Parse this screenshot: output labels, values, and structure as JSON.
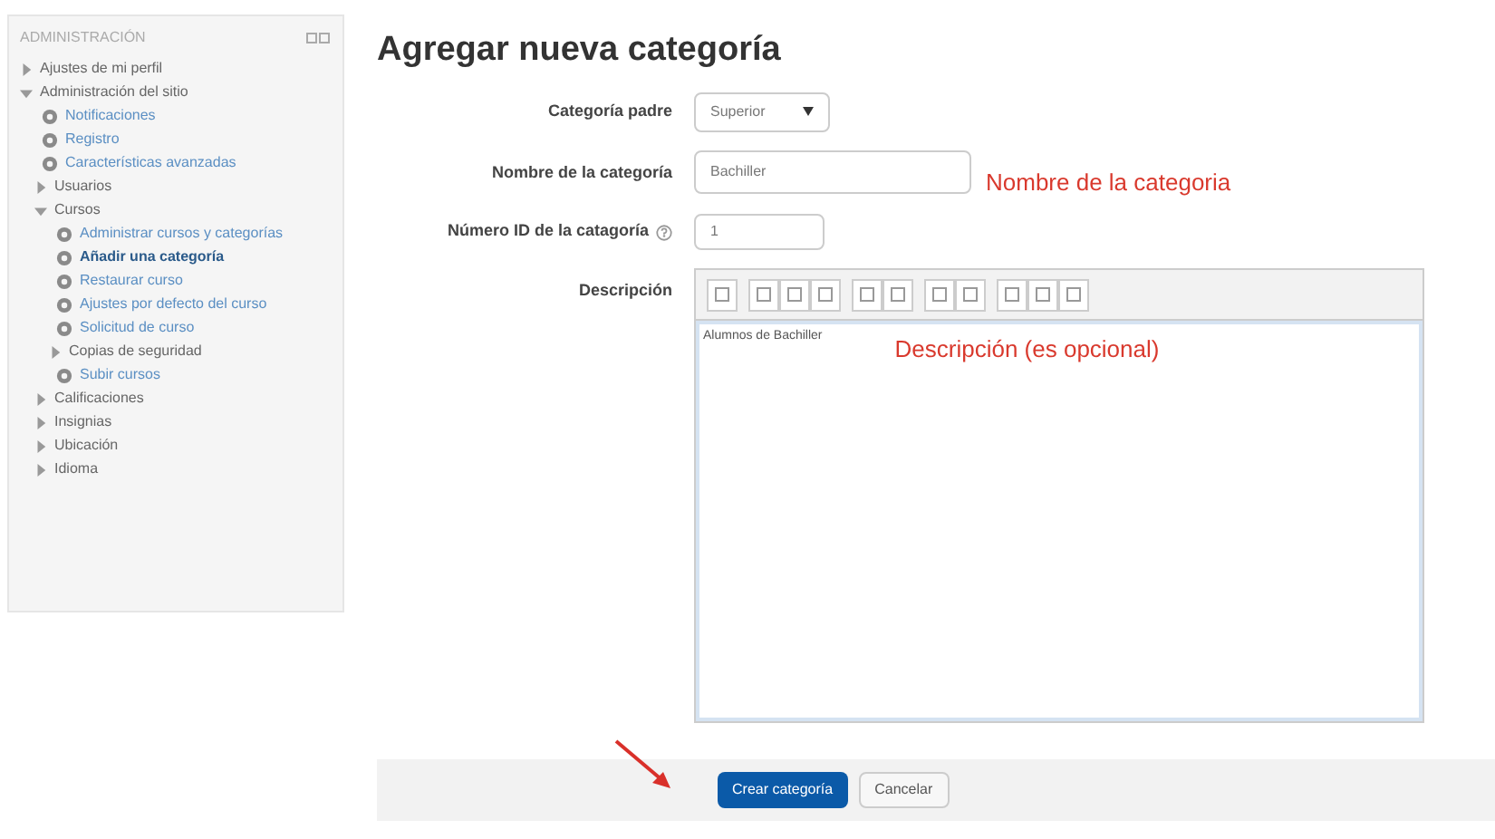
{
  "sidebar": {
    "title": "ADMINISTRACIÓN",
    "items": [
      {
        "kind": "branch",
        "label": "Ajustes de mi perfil",
        "expanded": false
      },
      {
        "kind": "branch",
        "label": "Administración del sitio",
        "expanded": true,
        "children": [
          {
            "kind": "link",
            "label": "Notificaciones",
            "selected": false
          },
          {
            "kind": "link",
            "label": "Registro",
            "selected": false
          },
          {
            "kind": "link",
            "label": "Características avanzadas",
            "selected": false
          },
          {
            "kind": "branch",
            "label": "Usuarios",
            "expanded": false
          },
          {
            "kind": "branch",
            "label": "Cursos",
            "expanded": true,
            "children": [
              {
                "kind": "link",
                "label": "Administrar cursos y categorías",
                "selected": false
              },
              {
                "kind": "link",
                "label": "Añadir una categoría",
                "selected": true
              },
              {
                "kind": "link",
                "label": "Restaurar curso",
                "selected": false
              },
              {
                "kind": "link",
                "label": "Ajustes por defecto del curso",
                "selected": false
              },
              {
                "kind": "link",
                "label": "Solicitud de curso",
                "selected": false
              },
              {
                "kind": "branch",
                "label": "Copias de seguridad",
                "expanded": false
              },
              {
                "kind": "link",
                "label": "Subir cursos",
                "selected": false
              }
            ]
          },
          {
            "kind": "branch",
            "label": "Calificaciones",
            "expanded": false
          },
          {
            "kind": "branch",
            "label": "Insignias",
            "expanded": false
          },
          {
            "kind": "branch",
            "label": "Ubicación",
            "expanded": false
          },
          {
            "kind": "branch",
            "label": "Idioma",
            "expanded": false
          }
        ]
      }
    ]
  },
  "form": {
    "title": "Agregar nueva categoría",
    "parent": {
      "label": "Categoría padre",
      "value": "Superior"
    },
    "name": {
      "label": "Nombre de la categoría",
      "value": "Bachiller",
      "annotation": "Nombre de la categoria"
    },
    "idnumber": {
      "label": "Número ID de la catagoría",
      "value": "1"
    },
    "description": {
      "label": "Descripción",
      "value": "Alumnos de Bachiller",
      "annotation": "Descripción (es opcional)"
    },
    "buttons": [
      {
        "label": "Crear categoría",
        "kind": "primary"
      },
      {
        "label": "Cancelar",
        "kind": "secondary"
      }
    ]
  }
}
